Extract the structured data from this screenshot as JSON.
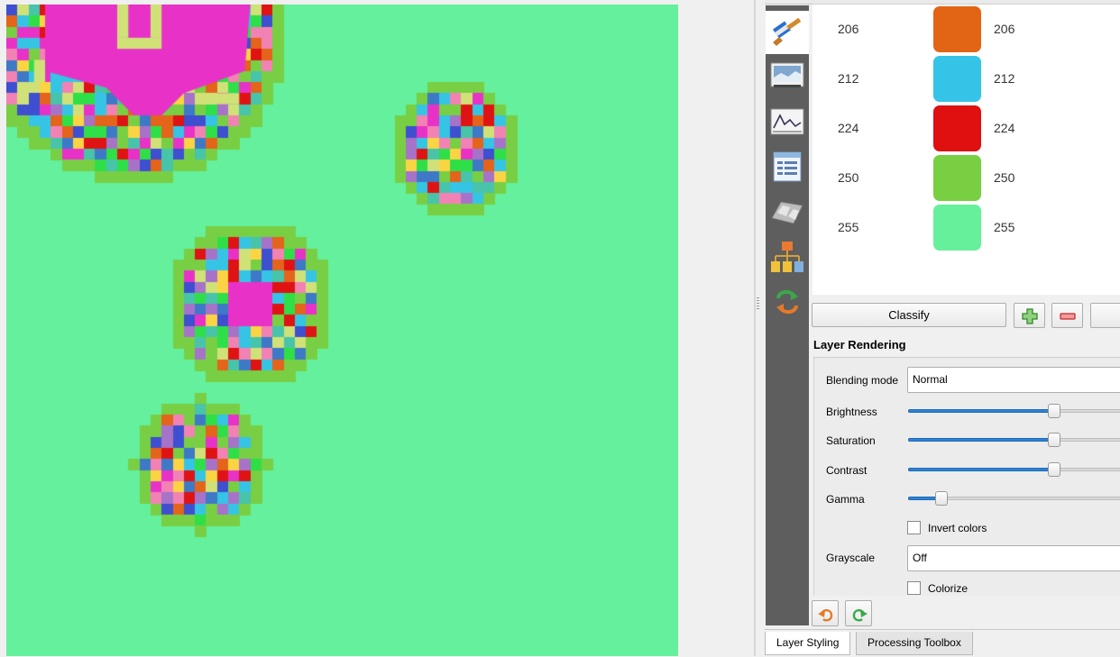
{
  "map": {
    "background": "#64f09c",
    "palette": [
      "#e3641a",
      "#36c4e5",
      "#df1313",
      "#78cf44",
      "#e832c7",
      "#d0e178",
      "#f282b3",
      "#3e4fd0",
      "#a673c9",
      "#2fdf47",
      "#47c4a9",
      "#fbd444",
      "#3e79c7"
    ]
  },
  "style_panel": {
    "classes": [
      {
        "value": "206",
        "color": "#e26516",
        "label": "206"
      },
      {
        "value": "212",
        "color": "#35c4e7",
        "label": "212"
      },
      {
        "value": "224",
        "color": "#df1010",
        "label": "224"
      },
      {
        "value": "250",
        "color": "#78cf42",
        "label": "250"
      },
      {
        "value": "255",
        "color": "#66f09c",
        "label": "255"
      }
    ],
    "classify_label": "Classify",
    "add_icon": "plus-icon",
    "remove_icon": "minus-icon"
  },
  "layer_rendering": {
    "title": "Layer Rendering",
    "blending_mode": {
      "label": "Blending mode",
      "value": "Normal"
    },
    "brightness": {
      "label": "Brightness",
      "level": 0.66
    },
    "saturation": {
      "label": "Saturation",
      "level": 0.66
    },
    "contrast": {
      "label": "Contrast",
      "level": 0.66
    },
    "gamma": {
      "label": "Gamma",
      "level": 0.15
    },
    "invert_colors": {
      "label": "Invert colors",
      "checked": false
    },
    "grayscale": {
      "label": "Grayscale",
      "value": "Off"
    },
    "colorize": {
      "label": "Colorize",
      "checked": false
    }
  },
  "tool_strip": {
    "icons": [
      "paintbrush-icon",
      "transparency-icon",
      "histogram-icon",
      "metadata-icon",
      "rendering-icon",
      "legend-icon",
      "history-icon"
    ]
  },
  "tabs": [
    {
      "label": "Layer Styling",
      "active": true
    },
    {
      "label": "Processing Toolbox",
      "active": false
    }
  ]
}
